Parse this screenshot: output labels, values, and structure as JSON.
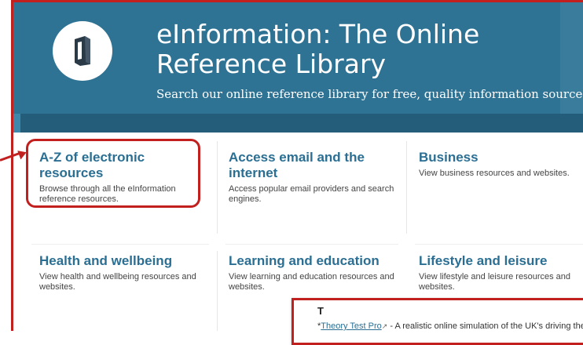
{
  "header": {
    "title": "eInformation: The Online Reference Library",
    "subtitle": "Search our online reference library for free, quality information sources."
  },
  "cards": [
    {
      "title": "A-Z of electronic resources",
      "desc": "Browse through all the eInformation reference resources."
    },
    {
      "title": "Access email and the internet",
      "desc": "Access popular email providers and search engines."
    },
    {
      "title": "Business",
      "desc": "View business resources and websites."
    },
    {
      "title": "Health and wellbeing",
      "desc": "View health and wellbeing resources and websites."
    },
    {
      "title": "Learning and education",
      "desc": "View learning and education resources and websites."
    },
    {
      "title": "Lifestyle and leisure",
      "desc": "View lifestyle and leisure resources and websites."
    }
  ],
  "popup": {
    "letter": "T",
    "prefix": "*",
    "link_text": "Theory Test Pro",
    "text": " - A realistic online simulation of the UK's driving theory"
  },
  "colors": {
    "header_bg": "#2f7394",
    "band": "#245d79",
    "link": "#2a6f93",
    "annotation": "#c21f1f"
  },
  "icons": {
    "logo": "book-icon",
    "external": "external-link-icon",
    "annotation": "arrow-icon"
  }
}
